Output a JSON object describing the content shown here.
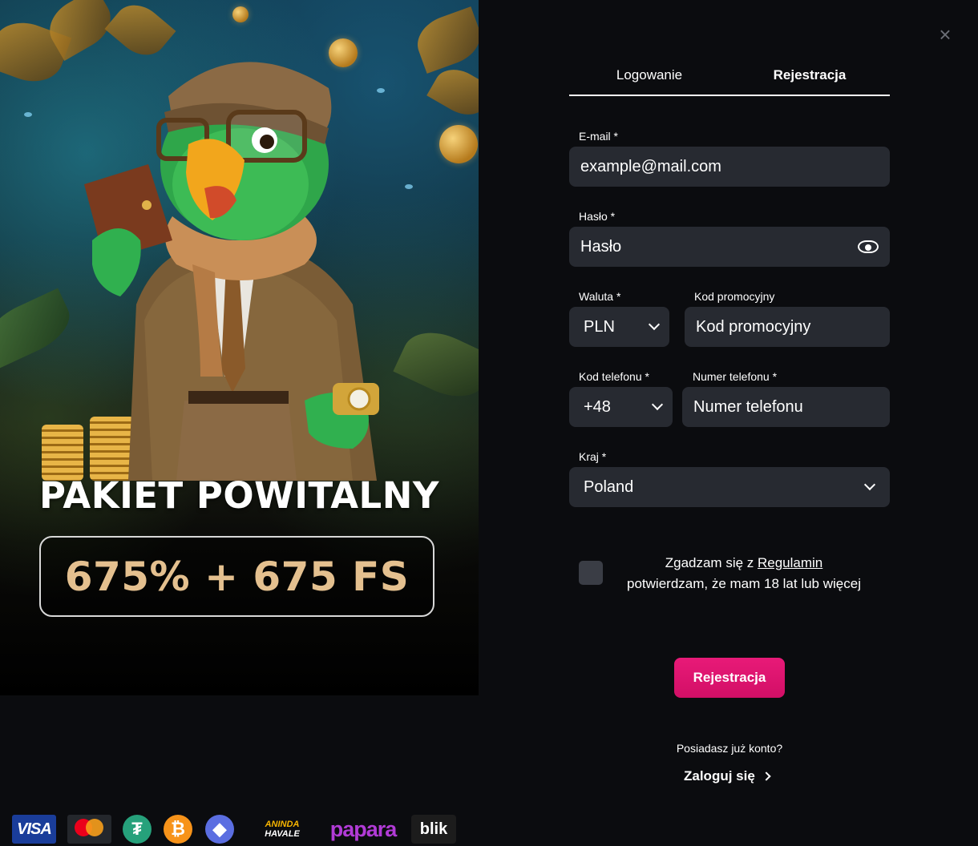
{
  "promo": {
    "headline": "PAKIET POWITALNY",
    "offer": "675% + 675 FS"
  },
  "payments": {
    "visa": "VISA",
    "tether": "₮",
    "bitcoin": "₿",
    "ethereum": "◆",
    "havale_top": "ANINDA",
    "havale_bottom": "HAVALE",
    "papara": "papara",
    "blik": "blik"
  },
  "tabs": {
    "login": "Logowanie",
    "register": "Rejestracja",
    "active": "register"
  },
  "form": {
    "email_label": "E-mail *",
    "email_value": "example@mail.com",
    "password_label": "Hasło *",
    "password_placeholder": "Hasło",
    "currency_label": "Waluta *",
    "currency_value": "PLN",
    "promo_label": "Kod promocyjny",
    "promo_placeholder": "Kod promocyjny",
    "phone_code_label": "Kod telefonu *",
    "phone_code_value": "+48",
    "phone_label": "Numer telefonu *",
    "phone_placeholder": "Numer telefonu",
    "country_label": "Kraj *",
    "country_value": "Poland",
    "consent_prefix": "Zgadzam się z ",
    "consent_link": "Regulamin",
    "consent_suffix": "potwierdzam, że mam 18 lat lub więcej",
    "submit": "Rejestracja"
  },
  "footer": {
    "have_account": "Posiadasz już konto?",
    "login_link": "Zaloguj się"
  },
  "colors": {
    "accent": "#e0146f",
    "field_bg": "#272a31",
    "background": "#0b0c0f",
    "offer_text": "#e4c08f"
  }
}
